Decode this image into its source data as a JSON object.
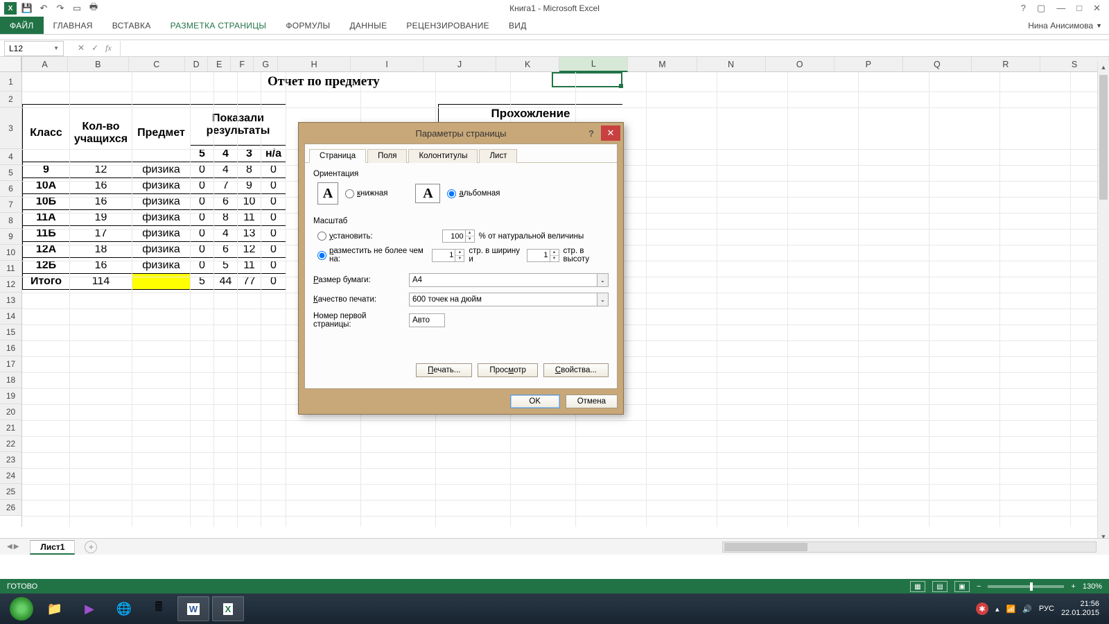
{
  "titlebar": {
    "title": "Книга1 - Microsoft Excel"
  },
  "ribbon": {
    "tabs": [
      "ФАЙЛ",
      "ГЛАВНАЯ",
      "ВСТАВКА",
      "РАЗМЕТКА СТРАНИЦЫ",
      "ФОРМУЛЫ",
      "ДАННЫЕ",
      "РЕЦЕНЗИРОВАНИЕ",
      "ВИД"
    ],
    "user": "Нина Анисимова"
  },
  "namebox": "L12",
  "columns": [
    "A",
    "B",
    "C",
    "D",
    "E",
    "F",
    "G",
    "H",
    "I",
    "J",
    "K",
    "L",
    "M",
    "N",
    "O",
    "P",
    "Q",
    "R",
    "S"
  ],
  "sheet": {
    "title": "Отчет по предмету",
    "h_col3": "Предмет",
    "h_col1": "Класс",
    "h_col2": "Кол-во учащихся",
    "h_col4": "Показали результаты",
    "sub": [
      "5",
      "4",
      "3",
      "н/а"
    ],
    "partial_header": "Прохожление",
    "rows": [
      {
        "a": "9",
        "b": "12",
        "c": "физика",
        "d": "0",
        "e": "4",
        "f": "8",
        "g": "0"
      },
      {
        "a": "10A",
        "b": "16",
        "c": "физика",
        "d": "0",
        "e": "7",
        "f": "9",
        "g": "0"
      },
      {
        "a": "10Б",
        "b": "16",
        "c": "физика",
        "d": "0",
        "e": "6",
        "f": "10",
        "g": "0"
      },
      {
        "a": "11A",
        "b": "19",
        "c": "физика",
        "d": "0",
        "e": "8",
        "f": "11",
        "g": "0"
      },
      {
        "a": "11Б",
        "b": "17",
        "c": "физика",
        "d": "0",
        "e": "4",
        "f": "13",
        "g": "0"
      },
      {
        "a": "12A",
        "b": "18",
        "c": "физика",
        "d": "0",
        "e": "6",
        "f": "12",
        "g": "0"
      },
      {
        "a": "12Б",
        "b": "16",
        "c": "физика",
        "d": "0",
        "e": "5",
        "f": "11",
        "g": "0"
      },
      {
        "a": "Итого",
        "b": "114",
        "c": "",
        "d": "5",
        "e": "44",
        "f": "77",
        "g": "0"
      }
    ]
  },
  "dialog": {
    "title": "Параметры страницы",
    "tabs": [
      "Страница",
      "Поля",
      "Колонтитулы",
      "Лист"
    ],
    "orientation_label": "Ориентация",
    "portrait": "книжная",
    "landscape": "альбомная",
    "scale_label": "Масштаб",
    "set_label": "установить:",
    "set_suffix": "% от натуральной величины",
    "set_value": "100",
    "fit_label": "разместить не более чем на:",
    "fit_w": "1",
    "fit_mid": "стр. в ширину и",
    "fit_h": "1",
    "fit_suffix": "стр. в высоту",
    "paper_label": "Размер бумаги:",
    "paper_value": "A4",
    "quality_label": "Качество печати:",
    "quality_value": "600 точек на дюйм",
    "firstpage_label": "Номер первой страницы:",
    "firstpage_value": "Авто",
    "btn_print": "Печать...",
    "btn_preview": "Просмотр",
    "btn_props": "Свойства...",
    "btn_ok": "OK",
    "btn_cancel": "Отмена"
  },
  "sheettab": "Лист1",
  "status": {
    "ready": "ГОТОВО",
    "zoom": "130%",
    "lang": "РУС"
  },
  "tray": {
    "time": "21:56",
    "date": "22.01.2015"
  }
}
